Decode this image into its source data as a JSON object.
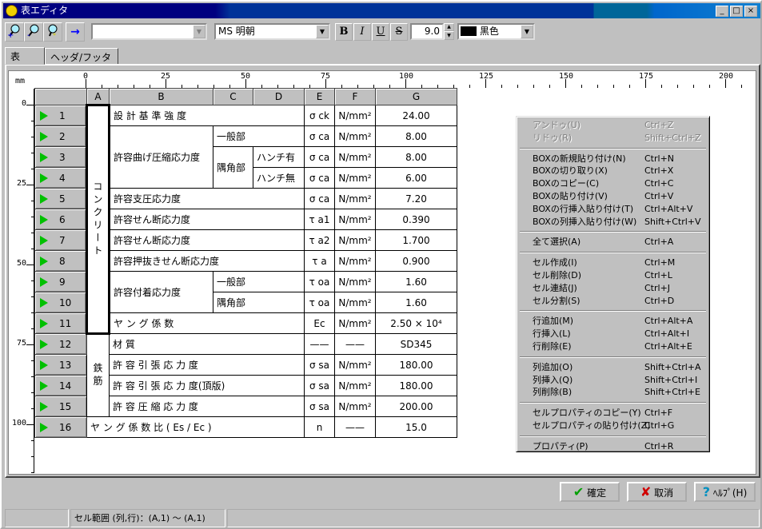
{
  "window": {
    "title": "表エディタ",
    "controls": [
      "_",
      "□",
      "×"
    ]
  },
  "toolbar": {
    "zoom_in": "zoom-in",
    "zoom_out": "zoom-out",
    "zoom_fit": "zoom-fit",
    "arrow": "→",
    "style_combo": "",
    "font": "MS 明朝",
    "bold": "B",
    "italic": "I",
    "underline": "U",
    "strike": "S",
    "font_size": "9.0",
    "color_name": "黒色",
    "color_hex": "#000000"
  },
  "tabs": [
    {
      "label": "表",
      "active": true
    },
    {
      "label": "ヘッダ/フッタ",
      "active": false
    }
  ],
  "ruler": {
    "unit": "mm",
    "h_labels": [
      "0",
      "25",
      "50",
      "75",
      "100",
      "125",
      "150",
      "175",
      "200"
    ],
    "v_labels": [
      "0",
      "25",
      "50",
      "75",
      "100"
    ]
  },
  "table": {
    "col_headers": [
      "A",
      "B",
      "C",
      "D",
      "E",
      "F",
      "G"
    ],
    "row_numbers": [
      "1",
      "2",
      "3",
      "4",
      "5",
      "6",
      "7",
      "8",
      "9",
      "10",
      "11",
      "12",
      "13",
      "14",
      "15",
      "16"
    ],
    "rows": [
      [
        {
          "t": "コンクリート",
          "rs": 11,
          "cls": "vert sel"
        },
        {
          "t": "設 計 基 準 強 度",
          "cs": 3
        },
        {
          "t": "σ ck",
          "cls": "c"
        },
        {
          "t": "N/mm²",
          "cls": "c"
        },
        {
          "t": "24.00",
          "cls": "c"
        }
      ],
      [
        {
          "t": "許容曲げ圧縮応力度",
          "rs": 3
        },
        {
          "t": "一般部",
          "cs": 2
        },
        {
          "t": "σ ca",
          "cls": "c"
        },
        {
          "t": "N/mm²",
          "cls": "c"
        },
        {
          "t": "8.00",
          "cls": "c"
        }
      ],
      [
        {
          "t": "隅角部",
          "rs": 2
        },
        {
          "t": "ハンチ有"
        },
        {
          "t": "σ ca",
          "cls": "c"
        },
        {
          "t": "N/mm²",
          "cls": "c"
        },
        {
          "t": "8.00",
          "cls": "c"
        }
      ],
      [
        {
          "t": "ハンチ無"
        },
        {
          "t": "σ ca",
          "cls": "c"
        },
        {
          "t": "N/mm²",
          "cls": "c"
        },
        {
          "t": "6.00",
          "cls": "c"
        }
      ],
      [
        {
          "t": "許容支圧応力度",
          "cs": 3
        },
        {
          "t": "σ ca",
          "cls": "c"
        },
        {
          "t": "N/mm²",
          "cls": "c"
        },
        {
          "t": "7.20",
          "cls": "c"
        }
      ],
      [
        {
          "t": "許容せん断応力度",
          "cs": 3
        },
        {
          "t": "τ a1",
          "cls": "c"
        },
        {
          "t": "N/mm²",
          "cls": "c"
        },
        {
          "t": "0.390",
          "cls": "c"
        }
      ],
      [
        {
          "t": "許容せん断応力度",
          "cs": 3
        },
        {
          "t": "τ a2",
          "cls": "c"
        },
        {
          "t": "N/mm²",
          "cls": "c"
        },
        {
          "t": "1.700",
          "cls": "c"
        }
      ],
      [
        {
          "t": "許容押抜きせん断応力度",
          "cs": 3
        },
        {
          "t": "τ a",
          "cls": "c"
        },
        {
          "t": "N/mm²",
          "cls": "c"
        },
        {
          "t": "0.900",
          "cls": "c"
        }
      ],
      [
        {
          "t": "許容付着応力度",
          "rs": 2
        },
        {
          "t": "一般部",
          "cs": 2
        },
        {
          "t": "τ oa",
          "cls": "c"
        },
        {
          "t": "N/mm²",
          "cls": "c"
        },
        {
          "t": "1.60",
          "cls": "c"
        }
      ],
      [
        {
          "t": "隅角部",
          "cs": 2
        },
        {
          "t": "τ oa",
          "cls": "c"
        },
        {
          "t": "N/mm²",
          "cls": "c"
        },
        {
          "t": "1.60",
          "cls": "c"
        }
      ],
      [
        {
          "t": "ヤ ン グ 係 数",
          "cs": 3
        },
        {
          "t": "Ec",
          "cls": "c"
        },
        {
          "t": "N/mm²",
          "cls": "c"
        },
        {
          "t": "2.50 × 10⁴",
          "cls": "c"
        }
      ],
      [
        {
          "t": "鉄筋",
          "rs": 4,
          "cls": "vert"
        },
        {
          "t": "材 質",
          "cs": 3
        },
        {
          "t": "——",
          "cls": "c"
        },
        {
          "t": "——",
          "cls": "c"
        },
        {
          "t": "SD345",
          "cls": "c"
        }
      ],
      [
        {
          "t": "許 容 引 張 応 力 度",
          "cs": 3
        },
        {
          "t": "σ sa",
          "cls": "c"
        },
        {
          "t": "N/mm²",
          "cls": "c"
        },
        {
          "t": "180.00",
          "cls": "c"
        }
      ],
      [
        {
          "t": "許 容 引 張 応 力 度(頂版)",
          "cs": 3
        },
        {
          "t": "σ sa",
          "cls": "c"
        },
        {
          "t": "N/mm²",
          "cls": "c"
        },
        {
          "t": "180.00",
          "cls": "c"
        }
      ],
      [
        {
          "t": "許 容 圧 縮 応 力 度",
          "cs": 3
        },
        {
          "t": "σ sa",
          "cls": "c"
        },
        {
          "t": "N/mm²",
          "cls": "c"
        },
        {
          "t": "200.00",
          "cls": "c"
        }
      ],
      [
        {
          "t": "ヤ ン グ 係 数 比 ( Es / Ec )",
          "cs": 4
        },
        {
          "t": "n",
          "cls": "c"
        },
        {
          "t": "——",
          "cls": "c"
        },
        {
          "t": "15.0",
          "cls": "c"
        }
      ]
    ]
  },
  "context_menu": [
    [
      {
        "label": "アンドゥ(U)",
        "shortcut": "Ctrl+Z",
        "disabled": true
      },
      {
        "label": "リドゥ(R)",
        "shortcut": "Shift+Ctrl+Z",
        "disabled": true
      }
    ],
    [
      {
        "label": "BOXの新規貼り付け(N)",
        "shortcut": "Ctrl+N"
      },
      {
        "label": "BOXの切り取り(X)",
        "shortcut": "Ctrl+X"
      },
      {
        "label": "BOXのコピー(C)",
        "shortcut": "Ctrl+C"
      },
      {
        "label": "BOXの貼り付け(V)",
        "shortcut": "Ctrl+V"
      },
      {
        "label": "BOXの行挿入貼り付け(T)",
        "shortcut": "Ctrl+Alt+V"
      },
      {
        "label": "BOXの列挿入貼り付け(W)",
        "shortcut": "Shift+Ctrl+V"
      }
    ],
    [
      {
        "label": "全て選択(A)",
        "shortcut": "Ctrl+A"
      }
    ],
    [
      {
        "label": "セル作成(I)",
        "shortcut": "Ctrl+M"
      },
      {
        "label": "セル削除(D)",
        "shortcut": "Ctrl+L"
      },
      {
        "label": "セル連結(J)",
        "shortcut": "Ctrl+J"
      },
      {
        "label": "セル分割(S)",
        "shortcut": "Ctrl+D"
      }
    ],
    [
      {
        "label": "行追加(M)",
        "shortcut": "Ctrl+Alt+A"
      },
      {
        "label": "行挿入(L)",
        "shortcut": "Ctrl+Alt+I"
      },
      {
        "label": "行削除(E)",
        "shortcut": "Ctrl+Alt+E"
      }
    ],
    [
      {
        "label": "列追加(O)",
        "shortcut": "Shift+Ctrl+A"
      },
      {
        "label": "列挿入(Q)",
        "shortcut": "Shift+Ctrl+I"
      },
      {
        "label": "列削除(B)",
        "shortcut": "Shift+Ctrl+E"
      }
    ],
    [
      {
        "label": "セルプロパティのコピー(Y)",
        "shortcut": "Ctrl+F"
      },
      {
        "label": "セルプロパティの貼り付け(Z)",
        "shortcut": "Ctrl+G"
      }
    ],
    [
      {
        "label": "プロパティ(P)",
        "shortcut": "Ctrl+R"
      }
    ]
  ],
  "buttons": {
    "ok": "確定",
    "cancel": "取消",
    "help": "ﾍﾙﾌﾟ(H)"
  },
  "status": {
    "left": "",
    "cell_range": "セル範囲 (列,行)：(A,1) ～ (A,1)",
    "right": ""
  }
}
